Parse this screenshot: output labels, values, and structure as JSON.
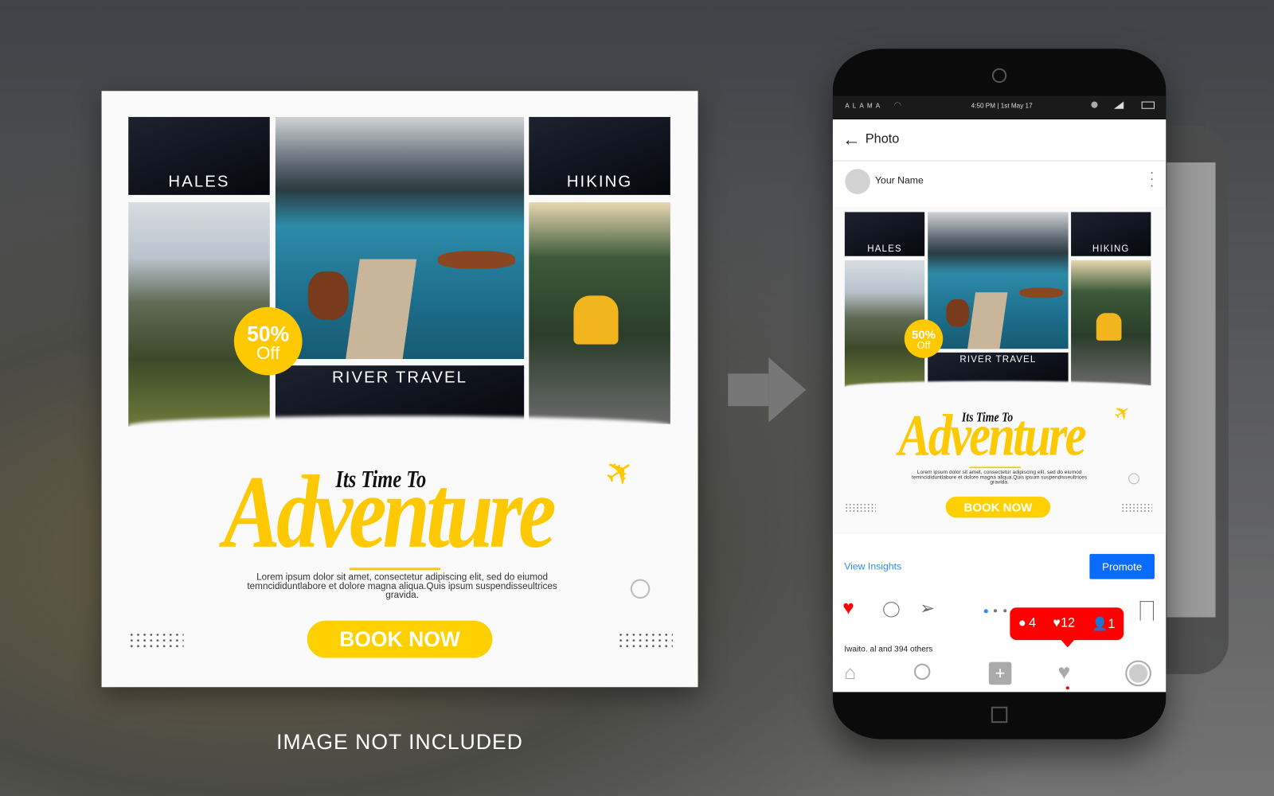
{
  "post": {
    "tiles": {
      "hales": "HALES",
      "hiking": "HIKING",
      "river": "RIVER TRAVEL"
    },
    "badge": {
      "percent": "50%",
      "off": "Off"
    },
    "headline_small": "Its Time To",
    "headline": "Adventure",
    "body": "Lorem ipsum dolor sit amet, consectetur adipiscing elit, sed do eiumod temncididuntlabore et dolore magna aliqua.Quis ipsum suspendisseultrices gravida.",
    "cta": "BOOK NOW",
    "accent": "#fec900"
  },
  "caption": "IMAGE NOT INCLUDED",
  "phone": {
    "status": {
      "carrier": "ALAMA",
      "time": "4:50 PM | 1st May 17"
    },
    "header": {
      "title": "Photo"
    },
    "user": {
      "name": "Your Name"
    },
    "insights": "View Insights",
    "promote": "Promote",
    "notification": {
      "comments": "4",
      "likes": "12",
      "followers": "1",
      "color": "#ff0000"
    },
    "likes_text": "Iwaito. al   and 394 others",
    "promote_color": "#0a6cff"
  }
}
